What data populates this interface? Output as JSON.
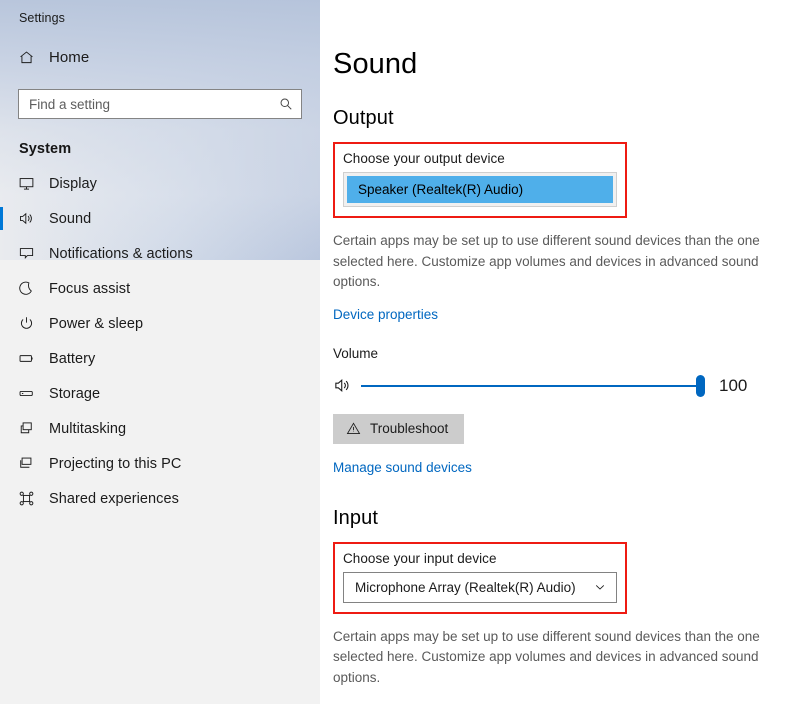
{
  "window": {
    "title": "Settings"
  },
  "sidebar": {
    "home": {
      "label": "Home",
      "icon": "home-icon"
    },
    "search": {
      "placeholder": "Find a setting",
      "icon": "search-icon"
    },
    "section_header": "System",
    "items": [
      {
        "label": "Display",
        "icon": "monitor-icon",
        "selected": false
      },
      {
        "label": "Sound",
        "icon": "speaker-icon",
        "selected": true
      },
      {
        "label": "Notifications & actions",
        "icon": "chat-bubble-icon",
        "selected": false
      },
      {
        "label": "Focus assist",
        "icon": "moon-icon",
        "selected": false
      },
      {
        "label": "Power & sleep",
        "icon": "power-icon",
        "selected": false
      },
      {
        "label": "Battery",
        "icon": "battery-icon",
        "selected": false
      },
      {
        "label": "Storage",
        "icon": "storage-icon",
        "selected": false
      },
      {
        "label": "Multitasking",
        "icon": "windows-stack-icon",
        "selected": false
      },
      {
        "label": "Projecting to this PC",
        "icon": "projector-icon",
        "selected": false
      },
      {
        "label": "Shared experiences",
        "icon": "share-icon",
        "selected": false
      }
    ]
  },
  "main": {
    "page_title": "Sound",
    "output": {
      "heading": "Output",
      "field_label": "Choose your output device",
      "selected_device": "Speaker (Realtek(R) Audio)",
      "description": "Certain apps may be set up to use different sound devices than the one selected here. Customize app volumes and devices in advanced sound options.",
      "device_properties_link": "Device properties",
      "volume_label": "Volume",
      "volume_value": "100",
      "volume_percent": 100,
      "volume_icon": "speaker-icon",
      "troubleshoot_button": "Troubleshoot",
      "troubleshoot_icon": "warning-triangle-icon",
      "manage_devices_link": "Manage sound devices"
    },
    "input": {
      "heading": "Input",
      "field_label": "Choose your input device",
      "selected_device": "Microphone Array (Realtek(R) Audio)",
      "dropdown_icon": "chevron-down-icon",
      "description": "Certain apps may be set up to use different sound devices than the one selected here. Customize app volumes and devices in advanced sound options."
    }
  },
  "colors": {
    "accent_blue": "#0067c0",
    "selection_blue": "#4fafea",
    "annotation_red": "#ee1b13",
    "link_blue": "#0067c0",
    "sidebar_bg": "#f2f2f2"
  }
}
